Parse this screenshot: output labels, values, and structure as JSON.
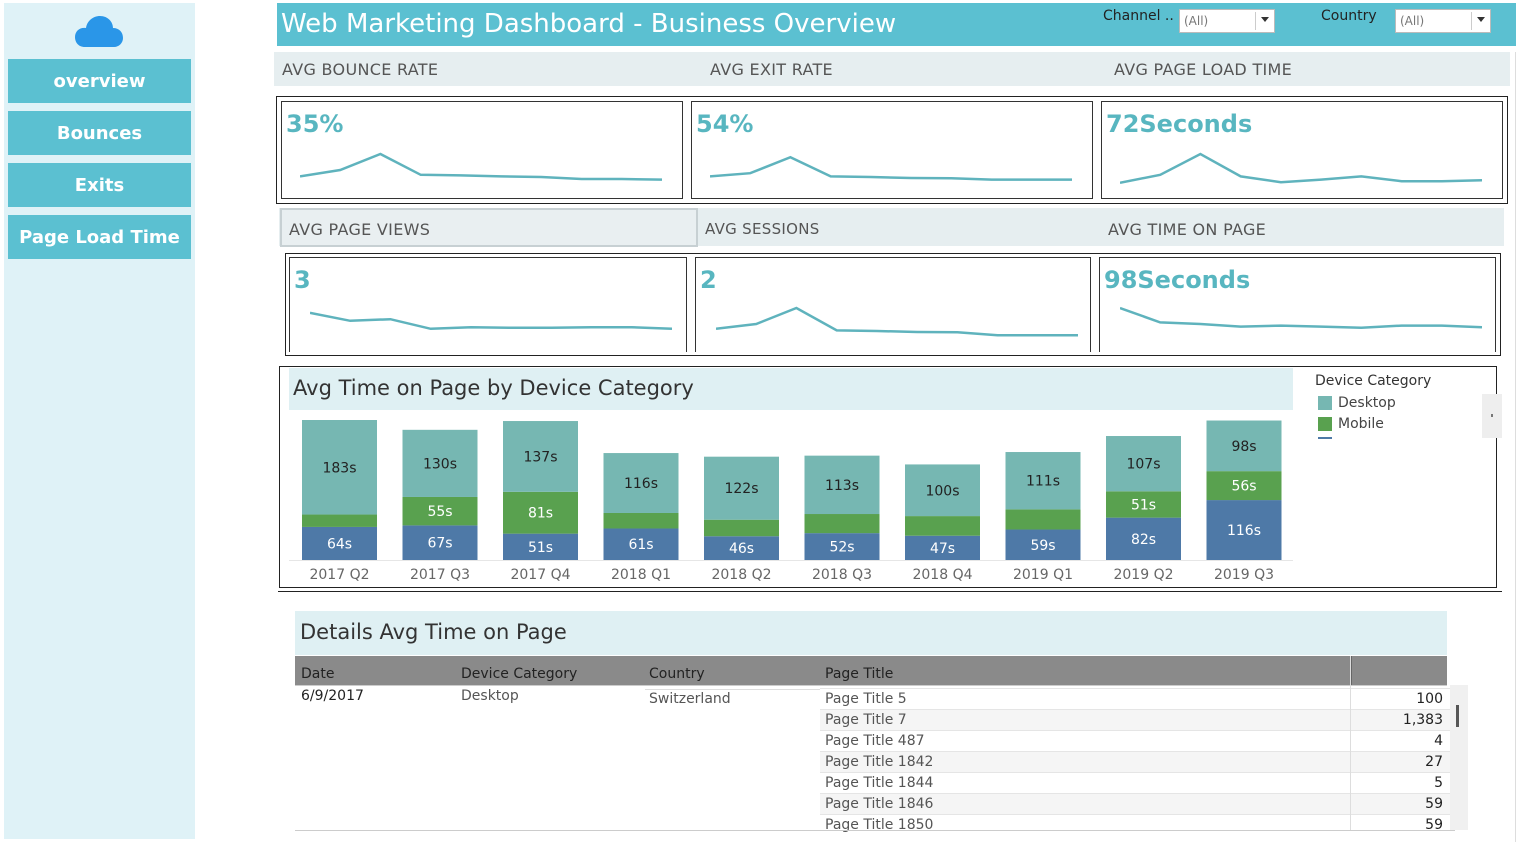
{
  "sidebar": {
    "logo_icon": "cloud-icon",
    "items": [
      {
        "label": "overview"
      },
      {
        "label": "Bounces"
      },
      {
        "label": "Exits"
      },
      {
        "label": "Page Load Time"
      }
    ]
  },
  "header": {
    "title": "Web Marketing Dashboard - Business Overview",
    "filters": [
      {
        "label": "Channel ..",
        "value": "(All)"
      },
      {
        "label": "Country",
        "value": "(All)"
      }
    ]
  },
  "kpis": [
    {
      "label": "AVG BOUNCE RATE",
      "value": "35%",
      "spark": [
        0.3,
        0.5,
        1.0,
        0.35,
        0.33,
        0.3,
        0.28,
        0.22,
        0.22,
        0.2
      ]
    },
    {
      "label": "AVG EXIT RATE",
      "value": "54%",
      "spark": [
        0.3,
        0.4,
        0.9,
        0.3,
        0.28,
        0.25,
        0.24,
        0.2,
        0.2,
        0.2
      ]
    },
    {
      "label": "AVG PAGE LOAD TIME",
      "value": "72Seconds",
      "spark": [
        0.1,
        0.35,
        1.0,
        0.3,
        0.12,
        0.2,
        0.3,
        0.15,
        0.15,
        0.18
      ]
    },
    {
      "label": "AVG PAGE VIEWS",
      "value": "3",
      "spark": [
        0.85,
        0.6,
        0.65,
        0.35,
        0.4,
        0.38,
        0.38,
        0.4,
        0.4,
        0.35
      ]
    },
    {
      "label": "AVG SESSIONS",
      "value": "2",
      "spark": [
        0.35,
        0.5,
        1.0,
        0.3,
        0.28,
        0.25,
        0.24,
        0.15,
        0.15,
        0.15
      ]
    },
    {
      "label": "AVG TIME ON PAGE",
      "value": "98Seconds",
      "spark": [
        1.0,
        0.55,
        0.5,
        0.42,
        0.45,
        0.42,
        0.38,
        0.45,
        0.45,
        0.4
      ]
    }
  ],
  "chart_data": {
    "type": "bar",
    "title": "Avg Time on Page by Device Category",
    "legend_title": "Device Category",
    "legend": [
      {
        "name": "Desktop",
        "color": "#76b7b2"
      },
      {
        "name": "Mobile",
        "color": "#59a14f"
      }
    ],
    "categories": [
      "2017 Q2",
      "2017 Q3",
      "2017 Q4",
      "2018 Q1",
      "2018 Q2",
      "2018 Q3",
      "2018 Q4",
      "2019 Q1",
      "2019 Q2",
      "2019 Q3"
    ],
    "series": [
      {
        "color": "#4e79a7",
        "values": [
          64,
          67,
          51,
          61,
          46,
          52,
          47,
          59,
          82,
          116
        ],
        "labels": [
          "64s",
          "67s",
          "51s",
          "61s",
          "46s",
          "52s",
          "47s",
          "59s",
          "82s",
          "116s"
        ]
      },
      {
        "name": "Mobile",
        "color": "#59a14f",
        "values": [
          24,
          55,
          81,
          30,
          32,
          37,
          38,
          39,
          51,
          56
        ],
        "labels": [
          "",
          "55s",
          "81s",
          "",
          "",
          "",
          "",
          "",
          "51s",
          "56s"
        ]
      },
      {
        "name": "Desktop",
        "color": "#76b7b2",
        "values": [
          183,
          130,
          137,
          116,
          122,
          113,
          100,
          111,
          107,
          98
        ],
        "labels": [
          "183s",
          "130s",
          "137s",
          "116s",
          "122s",
          "113s",
          "100s",
          "111s",
          "107s",
          "98s"
        ]
      }
    ]
  },
  "details": {
    "title": "Details Avg Time on Page",
    "columns": [
      "Date",
      "Device Category",
      "Country",
      "Page Title"
    ],
    "date": "6/9/2017",
    "device": "Desktop",
    "country": "Switzerland",
    "rows": [
      {
        "page": "Page Title 5",
        "value": "100"
      },
      {
        "page": "Page Title 7",
        "value": "1,383"
      },
      {
        "page": "Page Title 487",
        "value": "4"
      },
      {
        "page": "Page Title 1842",
        "value": "27"
      },
      {
        "page": "Page Title 1844",
        "value": "5"
      },
      {
        "page": "Page Title 1846",
        "value": "59"
      },
      {
        "page": "Page Title 1850",
        "value": "59"
      }
    ]
  }
}
